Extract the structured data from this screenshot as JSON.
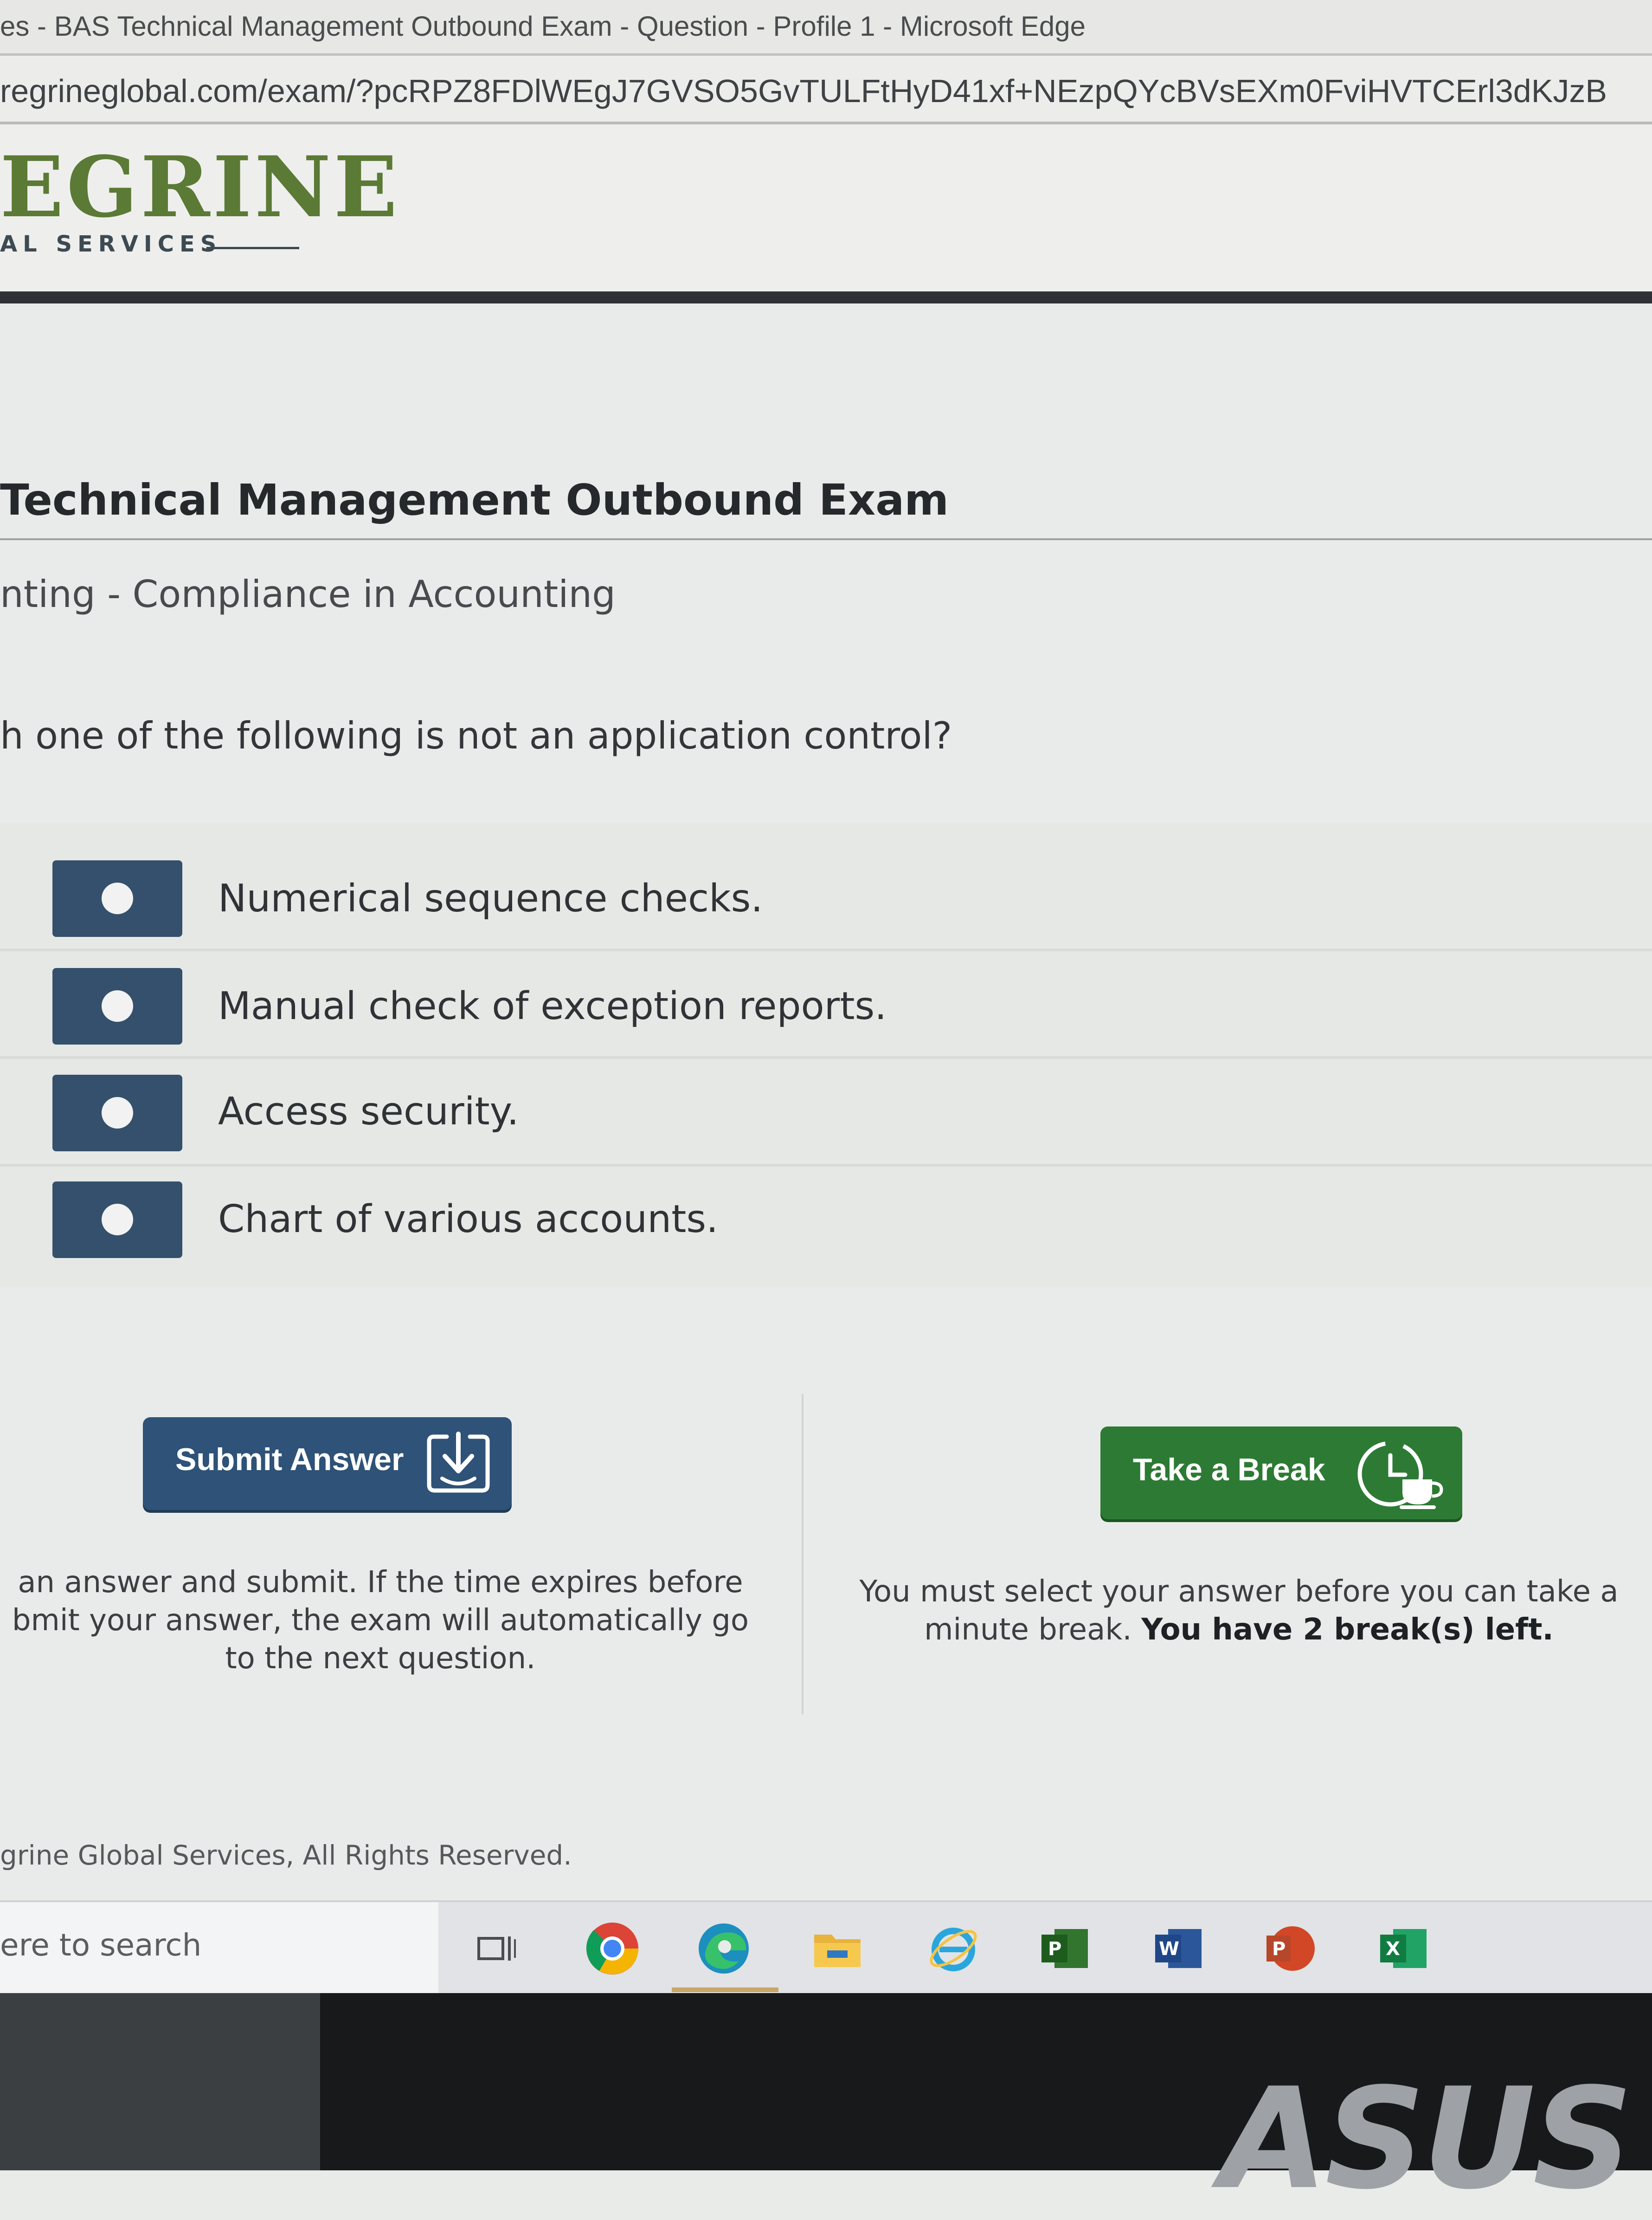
{
  "browser": {
    "window_title": "es - BAS Technical Management Outbound Exam - Question - Profile 1 - Microsoft Edge",
    "address": "regrineglobal.com/exam/?pcRPZ8FDlWEgJ7GVSO5GvTULFtHyD41xf+NEzpQYcBVsEXm0FviHVTCErl3dKJzB"
  },
  "site": {
    "logo_text": "EGRINE",
    "logo_subtext": "AL SERVICES"
  },
  "exam": {
    "title": "Technical Management Outbound Exam",
    "subject": "nting - Compliance in Accounting",
    "question": "h one of the following is not an application control?",
    "options": [
      "Numerical sequence checks.",
      "Manual check of exception reports.",
      "Access security.",
      "Chart of various accounts."
    ]
  },
  "actions": {
    "submit_label": "Submit Answer",
    "submit_note_1": "an answer and submit. If the time expires before",
    "submit_note_2": "bmit your answer, the exam will automatically go",
    "submit_note_3": "to the next question.",
    "break_label": "Take a Break",
    "break_note_1": "You must select your answer before you can take a",
    "break_note_2": "minute break.",
    "break_note_bold": "You have 2 break(s) left."
  },
  "footer": {
    "copyright": "grine Global Services, All Rights Reserved."
  },
  "taskbar": {
    "search_placeholder": "ere to search",
    "icons": [
      "task-view-icon",
      "chrome-icon",
      "edge-icon",
      "file-explorer-icon",
      "internet-explorer-icon",
      "project-icon",
      "word-icon",
      "powerpoint-icon",
      "excel-icon"
    ]
  },
  "monitor": {
    "brand": "ASUS"
  },
  "colors": {
    "logo_green": "#5b7a35",
    "option_button": "#34506c",
    "submit_button": "#2e5278",
    "break_button": "#2d7a34"
  }
}
